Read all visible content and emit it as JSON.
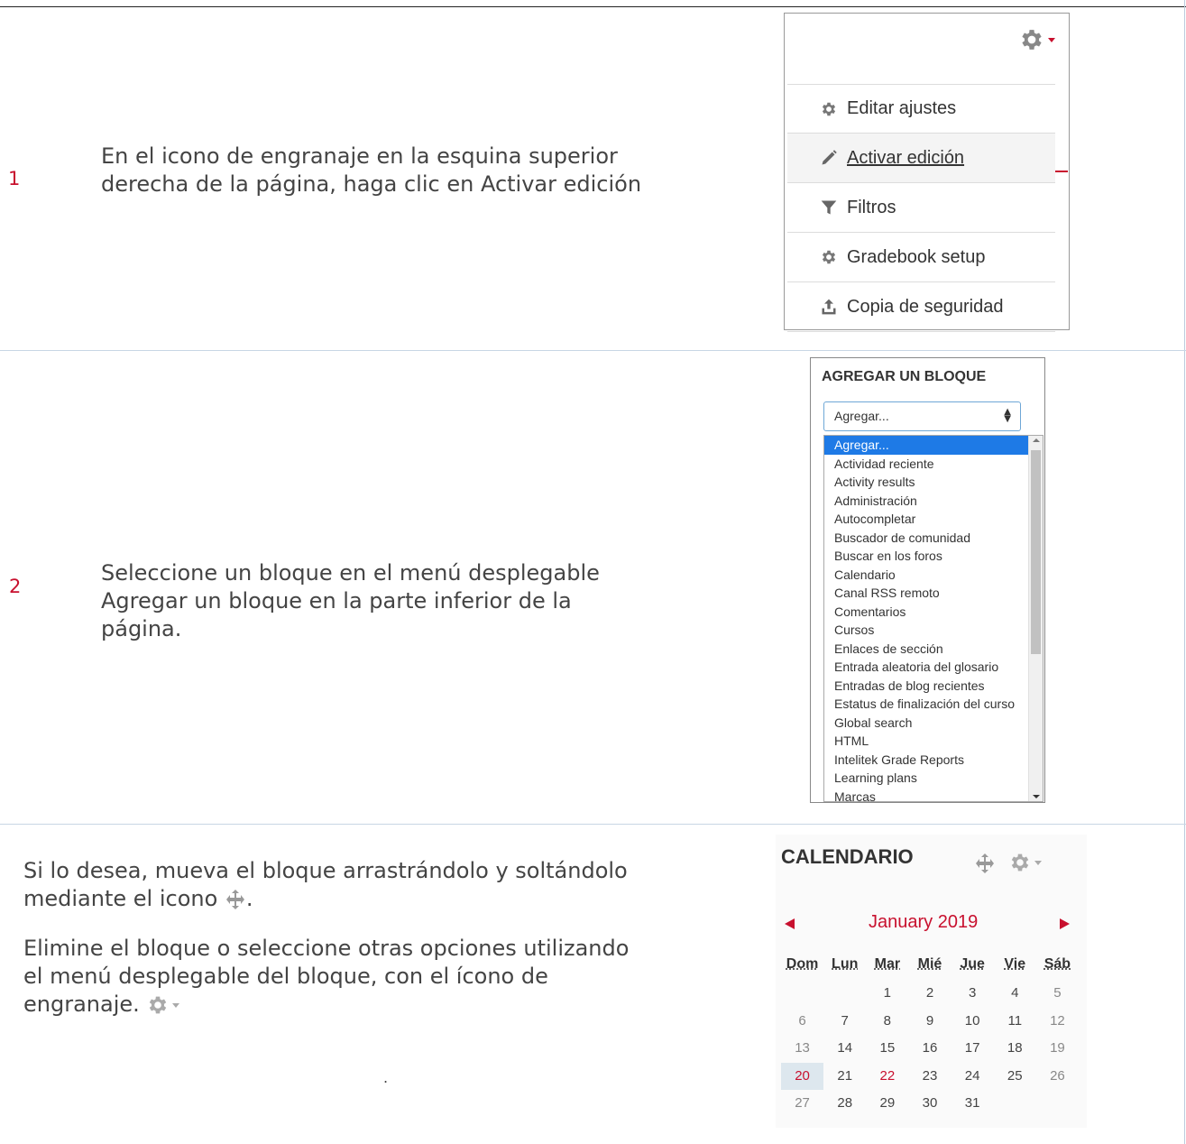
{
  "steps": [
    {
      "number": "1",
      "text_lines": [
        "En el icono de engranaje en la esquina superior",
        "derecha de la página, haga clic en Activar edición"
      ]
    },
    {
      "number": "2",
      "text_lines": [
        "Seleccione un bloque en el menú desplegable",
        "Agregar un bloque en la parte inferior de la",
        "página."
      ]
    },
    {
      "paragraph1_lines": [
        "Si lo desea, mueva el bloque arrastrándolo y soltándolo",
        "mediante el icono",
        "."
      ],
      "paragraph2_lines": [
        "Elimine el bloque o seleccione otras opciones utilizando",
        "el menú desplegable del bloque, con el ícono de",
        "engranaje."
      ],
      "trailing_dot": "."
    }
  ],
  "gear_menu": {
    "items": [
      {
        "label": "Editar ajustes",
        "icon": "gear-icon"
      },
      {
        "label": "Activar edición",
        "icon": "pencil-icon",
        "active": true
      },
      {
        "label": "Filtros",
        "icon": "filter-icon"
      },
      {
        "label": "Gradebook setup",
        "icon": "gear-icon"
      },
      {
        "label": "Copia de seguridad",
        "icon": "upload-icon"
      }
    ]
  },
  "add_block": {
    "title": "AGREGAR UN BLOQUE",
    "selected_value": "Agregar...",
    "options": [
      "Agregar...",
      "Actividad reciente",
      "Activity results",
      "Administración",
      "Autocompletar",
      "Buscador de comunidad",
      "Buscar en los foros",
      "Calendario",
      "Canal RSS remoto",
      "Comentarios",
      "Cursos",
      "Enlaces de sección",
      "Entrada aleatoria del glosario",
      "Entradas de blog recientes",
      "Estatus de finalización del curso",
      "Global search",
      "HTML",
      "Intelitek Grade Reports",
      "Learning plans",
      "Marcas"
    ]
  },
  "calendar": {
    "title": "CALENDARIO",
    "month": "January 2019",
    "weekdays": [
      "Dom",
      "Lun",
      "Mar",
      "Mié",
      "Jue",
      "Vie",
      "Sáb"
    ],
    "weeks": [
      [
        "",
        "",
        "1",
        "2",
        "3",
        "4",
        "5"
      ],
      [
        "6",
        "7",
        "8",
        "9",
        "10",
        "11",
        "12"
      ],
      [
        "13",
        "14",
        "15",
        "16",
        "17",
        "18",
        "19"
      ],
      [
        "20",
        "21",
        "22",
        "23",
        "24",
        "25",
        "26"
      ],
      [
        "27",
        "28",
        "29",
        "30",
        "31",
        "",
        ""
      ]
    ],
    "today": "20",
    "highlighted": "22"
  },
  "colors": {
    "accent_red": "#c8102e",
    "selection_blue": "#1e7ae6"
  }
}
